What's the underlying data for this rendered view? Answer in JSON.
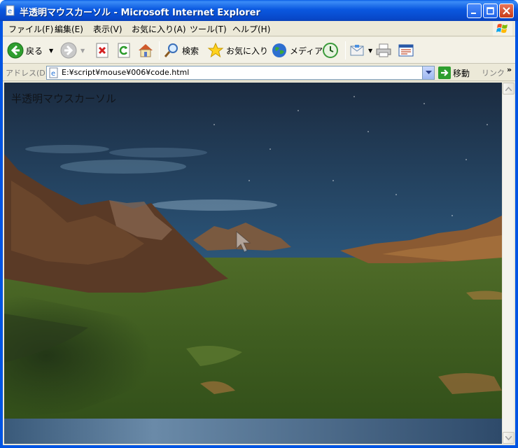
{
  "window": {
    "title": "半透明マウスカーソル - Microsoft Internet Explorer",
    "controls": [
      "minimize",
      "maximize",
      "close"
    ]
  },
  "menu": {
    "items": [
      "ファイル(F)",
      "編集(E)",
      "表示(V)",
      "お気に入り(A)",
      "ツール(T)",
      "ヘルプ(H)"
    ]
  },
  "toolbar": {
    "back_label": "戻る",
    "search_label": "検索",
    "favorites_label": "お気に入り",
    "media_label": "メディア"
  },
  "address": {
    "label": "アドレス(D)",
    "url": "E:¥script¥mouse¥006¥code.html",
    "go_label": "移動",
    "links_label": "リンク",
    "links_chevron": "»"
  },
  "page": {
    "heading": "半透明マウスカーソル"
  },
  "colors": {
    "title_blue": "#0a58e0",
    "chrome": "#ece9d8",
    "sky_top": "#1c2c40",
    "grass": "#3d5a1f"
  }
}
